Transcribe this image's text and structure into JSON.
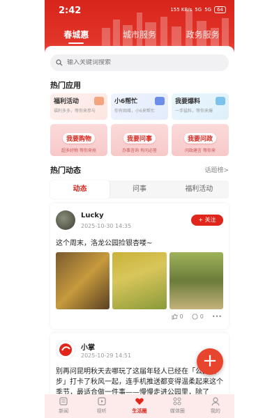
{
  "status": {
    "time": "2:42",
    "net_speed": "155 KB/s",
    "signal1": "5G",
    "signal2": "5G",
    "battery": "64"
  },
  "top_tabs": [
    "春城惠",
    "城市服务",
    "政务服务"
  ],
  "search": {
    "placeholder": "输入关键词搜索"
  },
  "hot_apps": {
    "title": "热门应用",
    "items": [
      {
        "name": "福利活动",
        "sub": "福利多多，等你来参与"
      },
      {
        "name": "小6帮忙",
        "sub": "你有困难，小6来帮忙"
      },
      {
        "name": "我要爆料",
        "sub": "一手猛料，等你来爆"
      }
    ],
    "banners": [
      {
        "name": "我要购物",
        "sub": "超多好物 等你来抢"
      },
      {
        "name": "我要问事",
        "sub": "办事咨询 有问必答"
      },
      {
        "name": "我要问政",
        "sub": "问政建言 等你来"
      }
    ]
  },
  "hot_feed": {
    "title": "热门动态",
    "more": "话题榜>"
  },
  "sub_tabs": [
    "动态",
    "问事",
    "福利活动"
  ],
  "posts": [
    {
      "user": "Lucky",
      "date": "2025-10-30 14:35",
      "follow": "+ 关注",
      "text": "这个周末，洛龙公园捡银杏喽~",
      "likes": "0",
      "comments": "0"
    },
    {
      "user": "小掌",
      "date": "2025-10-29 14:51",
      "text": "别再问昆明秋天去哪玩了这届年轻人已经在「公园漫步」打卡了秋风一起，连手机推送都变得温柔起来这个季节，最适合做一件事——慢慢走进公园里，除了"
    }
  ],
  "bottom_nav": [
    "新闻",
    "视听",
    "生活圈",
    "媒体圈",
    "我的"
  ],
  "colors": {
    "brand_red": "#d8241b",
    "fab": "#e8452f"
  }
}
